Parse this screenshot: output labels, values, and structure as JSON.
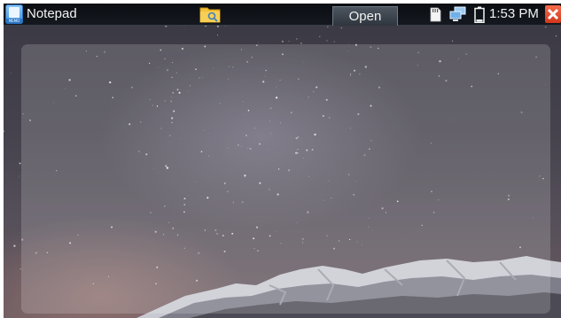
{
  "titlebar": {
    "app_title": "Notepad",
    "app_icon_tag": "MEMO",
    "open_label": "Open",
    "clock": "1:53 PM"
  },
  "icons": {
    "app": "notepad-icon",
    "folder": "folder-search-icon",
    "sdcard": "sd-card-icon",
    "network": "network-icon",
    "battery": "battery-icon",
    "close": "close-icon"
  },
  "editor": {
    "value": ""
  },
  "colors": {
    "accent_close": "#e04a2a",
    "folder": "#f4c23a"
  }
}
